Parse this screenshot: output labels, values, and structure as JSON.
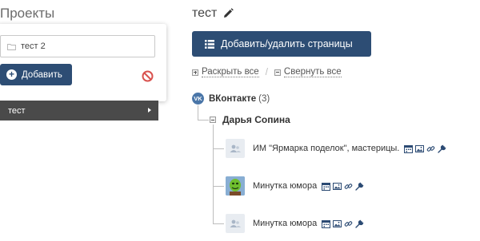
{
  "left": {
    "title": "Проекты",
    "new_project_input": {
      "value": "тест 2",
      "placeholder": ""
    },
    "add_button": "Добавить",
    "projects": [
      {
        "label": "тест"
      }
    ]
  },
  "right": {
    "title": "тест",
    "manage_pages_button": "Добавить/удалить страницы",
    "expand_all": "Раскрыть все",
    "separator": "/",
    "collapse_all": "Свернуть все",
    "network": {
      "name": "ВКонтакте",
      "count": "(3)"
    },
    "user": {
      "name": "Дарья Сопина"
    },
    "pages": [
      {
        "label": "ИМ \"Ярмарка поделок\", мастерицы.",
        "avatar": "placeholder-avatar"
      },
      {
        "label": "Минутка юмора",
        "avatar": "green-character-avatar"
      },
      {
        "label": "Минутка юмора",
        "avatar": "placeholder-avatar"
      }
    ]
  },
  "colors": {
    "primary_button": "#2d4d74",
    "selected_project": "#4a4a4a",
    "vk_blue": "#4a76a8",
    "cancel_red": "#d9534f"
  }
}
